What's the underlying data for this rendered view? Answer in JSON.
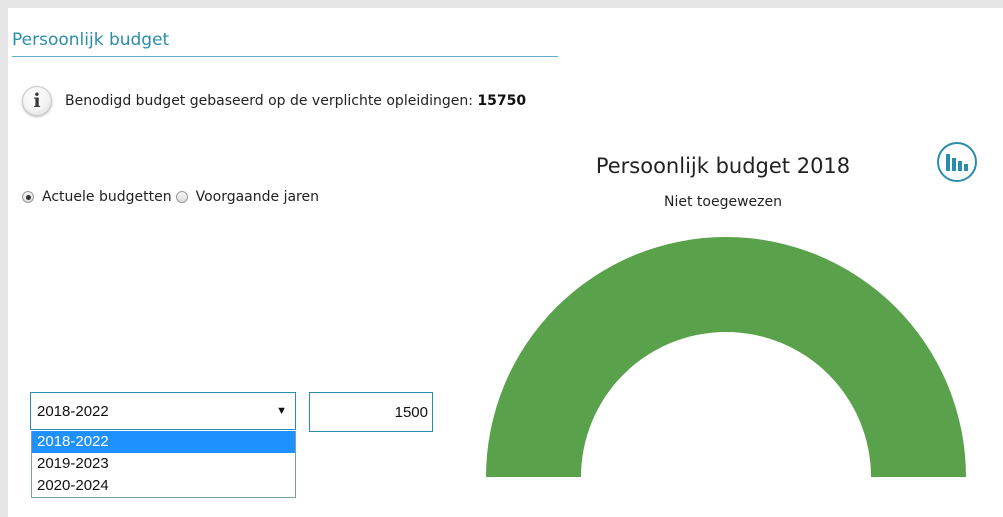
{
  "panel": {
    "title": "Persoonlijk budget"
  },
  "info": {
    "icon": "info-icon",
    "text": "Benodigd budget gebaseerd op de verplichte opleidingen:",
    "value": "15750"
  },
  "radios": [
    {
      "label": "Actuele budgetten",
      "checked": true
    },
    {
      "label": "Voorgaande jaren",
      "checked": false
    }
  ],
  "period_select": {
    "selected": "2018-2022",
    "options": [
      "2018-2022",
      "2019-2023",
      "2020-2024"
    ],
    "highlighted": "2018-2022"
  },
  "amount_input": {
    "value": "1500"
  },
  "chart_data": {
    "type": "pie",
    "title": "Persoonlijk budget 2018",
    "subtitle": "Niet toegewezen",
    "style": "semi-donut",
    "slices": [
      {
        "value": 100,
        "color": "#5aa14c"
      }
    ],
    "menu_icon": "bar-chart-icon"
  },
  "colors": {
    "accent": "#2a8dae",
    "chart_fill": "#5aa14c",
    "dropdown_highlight": "#1e90ff"
  }
}
